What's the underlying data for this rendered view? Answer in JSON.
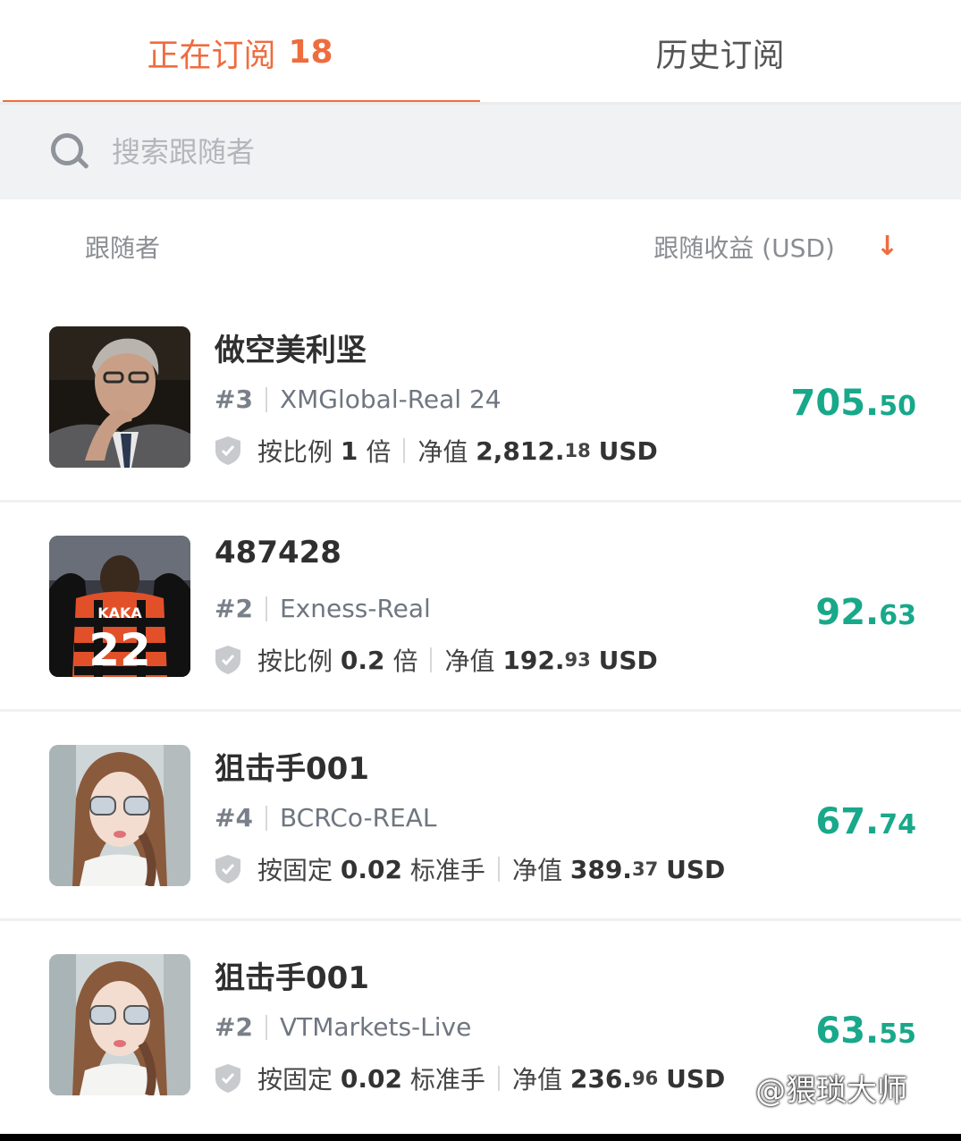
{
  "tabs": {
    "active_label": "正在订阅",
    "active_count": "18",
    "history_label": "历史订阅"
  },
  "search": {
    "placeholder": "搜索跟随者"
  },
  "list_header": {
    "follower_label": "跟随者",
    "profit_label": "跟随收益 (USD)",
    "sort_icon": "arrow-down-icon"
  },
  "rows": [
    {
      "name": "做空美利坚",
      "rank": "#3",
      "server": "XMGlobal-Real 24",
      "mode_prefix": "按比例",
      "mode_value": "1",
      "mode_unit": "倍",
      "equity_label": "净值",
      "equity_int": "2,812.",
      "equity_dec": "18",
      "currency": "USD",
      "profit_int": "705.",
      "profit_dec": "50"
    },
    {
      "name": "487428",
      "rank": "#2",
      "server": "Exness-Real",
      "mode_prefix": "按比例",
      "mode_value": "0.2",
      "mode_unit": "倍",
      "equity_label": "净值",
      "equity_int": "192.",
      "equity_dec": "93",
      "currency": "USD",
      "profit_int": "92.",
      "profit_dec": "63"
    },
    {
      "name": "狙击手001",
      "rank": "#4",
      "server": "BCRCo-REAL",
      "mode_prefix": "按固定",
      "mode_value": "0.02",
      "mode_unit": "标准手",
      "equity_label": "净值",
      "equity_int": "389.",
      "equity_dec": "37",
      "currency": "USD",
      "profit_int": "67.",
      "profit_dec": "74"
    },
    {
      "name": "狙击手001",
      "rank": "#2",
      "server": "VTMarkets-Live",
      "mode_prefix": "按固定",
      "mode_value": "0.02",
      "mode_unit": "标准手",
      "equity_label": "净值",
      "equity_int": "236.",
      "equity_dec": "96",
      "currency": "USD",
      "profit_int": "63.",
      "profit_dec": "55"
    }
  ],
  "watermark": "@猥琐大师",
  "colors": {
    "accent": "#ef6c3e",
    "profit": "#18a88a"
  }
}
